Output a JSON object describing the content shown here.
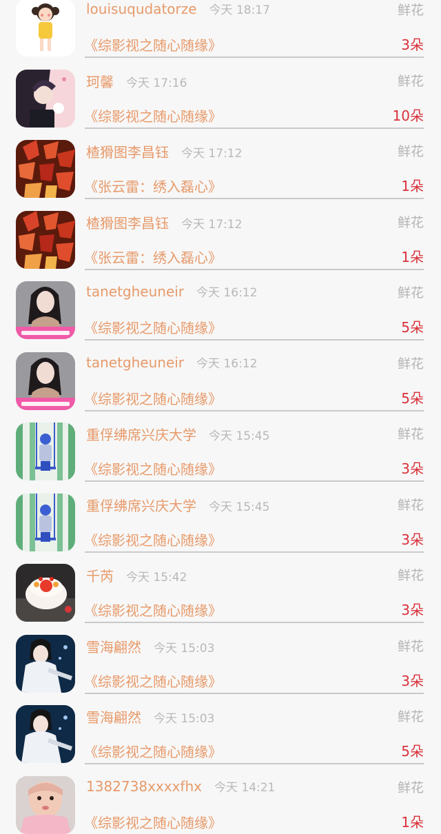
{
  "list": {
    "rows": [
      {
        "user": "louisuqudatorze",
        "time": "今天 18:17",
        "gift": "鲜花",
        "book": "《综影视之随心随缘》",
        "count": "3朵",
        "avatar": "avatar-girl-cartoon-icon"
      },
      {
        "user": "珂馨",
        "time": "今天 17:16",
        "gift": "鲜花",
        "book": "《综影视之随心随缘》",
        "count": "10朵",
        "avatar": "avatar-anime-couple-icon"
      },
      {
        "user": "楂猾图李昌钰",
        "time": "今天 17:12",
        "gift": "鲜花",
        "book": "《张云雷：绣入磊心》",
        "count": "1朵",
        "avatar": "avatar-red-leaves-icon"
      },
      {
        "user": "楂猾图李昌钰",
        "time": "今天 17:12",
        "gift": "鲜花",
        "book": "《张云雷：绣入磊心》",
        "count": "1朵",
        "avatar": "avatar-red-leaves-icon"
      },
      {
        "user": "tanetgheuneir",
        "time": "今天 16:12",
        "gift": "鲜花",
        "book": "《综影视之随心随缘》",
        "count": "5朵",
        "avatar": "avatar-woman-portrait-icon"
      },
      {
        "user": "tanetgheuneir",
        "time": "今天 16:12",
        "gift": "鲜花",
        "book": "《综影视之随心随缘》",
        "count": "5朵",
        "avatar": "avatar-woman-portrait-icon"
      },
      {
        "user": "重俘绋席兴庆大学",
        "time": "今天 15:45",
        "gift": "鲜花",
        "book": "《综影视之随心随缘》",
        "count": "3朵",
        "avatar": "avatar-swing-girl-icon"
      },
      {
        "user": "重俘绋席兴庆大学",
        "time": "今天 15:45",
        "gift": "鲜花",
        "book": "《综影视之随心随缘》",
        "count": "3朵",
        "avatar": "avatar-swing-girl-icon"
      },
      {
        "user": "千芮",
        "time": "今天 15:42",
        "gift": "鲜花",
        "book": "《综影视之随心随缘》",
        "count": "3朵",
        "avatar": "avatar-cake-icon"
      },
      {
        "user": "雪海翩然",
        "time": "今天 15:03",
        "gift": "鲜花",
        "book": "《综影视之随心随缘》",
        "count": "3朵",
        "avatar": "avatar-costume-man-icon"
      },
      {
        "user": "雪海翩然",
        "time": "今天 15:03",
        "gift": "鲜花",
        "book": "《综影视之随心随缘》",
        "count": "5朵",
        "avatar": "avatar-costume-man-icon"
      },
      {
        "user": "1382738xxxxfhx",
        "time": "今天 14:21",
        "gift": "鲜花",
        "book": "《综影视之随心随缘》",
        "count": "1朵",
        "avatar": "avatar-baby-icon"
      }
    ]
  }
}
